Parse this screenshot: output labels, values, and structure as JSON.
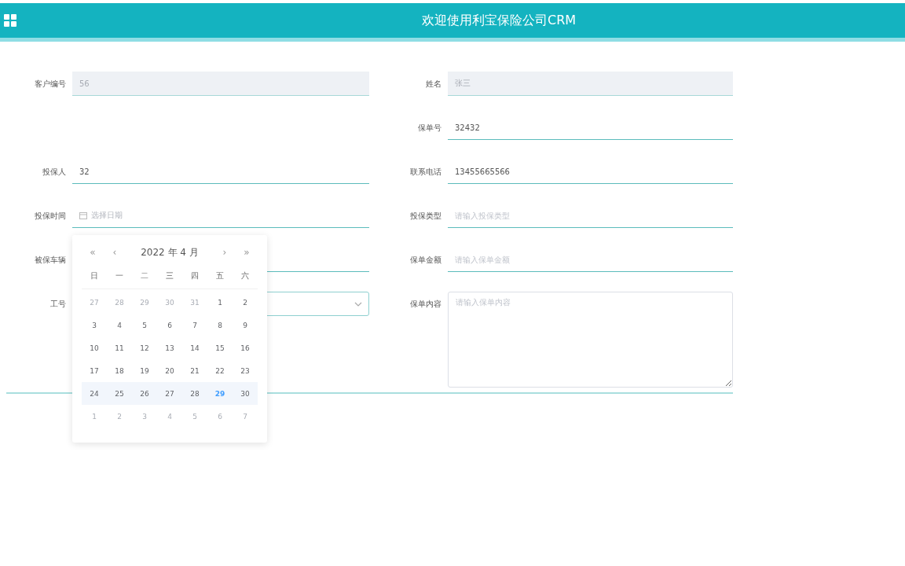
{
  "header": {
    "title": "欢迎使用利宝保险公司CRM"
  },
  "rows": [
    {
      "left": {
        "label": "客户编号",
        "kind": "input",
        "value": "56",
        "disabled": true
      },
      "right": {
        "label": "姓名",
        "kind": "input",
        "value": "张三",
        "disabled": true
      }
    },
    {
      "left": null,
      "right": {
        "label": "保单号",
        "kind": "input",
        "value": "32432",
        "disabled": false
      }
    },
    {
      "left": {
        "label": "投保人",
        "kind": "input",
        "value": "32",
        "disabled": false
      },
      "right": {
        "label": "联系电话",
        "kind": "input",
        "value": "13455665566",
        "disabled": false
      }
    },
    {
      "left": {
        "label": "投保时间",
        "kind": "date",
        "placeholder": "选择日期"
      },
      "right": {
        "label": "投保类型",
        "kind": "input",
        "placeholder": "请输入投保类型",
        "disabled": false
      }
    },
    {
      "left": {
        "label": "被保车辆",
        "kind": "input",
        "disabled": false
      },
      "right": {
        "label": "保单金额",
        "kind": "input",
        "placeholder": "请输入保单金额",
        "disabled": false
      }
    },
    {
      "left": {
        "label": "工号",
        "kind": "select"
      },
      "right": {
        "label": "保单内容",
        "kind": "textarea",
        "placeholder": "请输入保单内容"
      }
    }
  ],
  "calendar": {
    "prev_year": "«",
    "prev_month": "‹",
    "title": "2022 年  4 月",
    "next_month": "›",
    "next_year": "»",
    "weekdays": [
      "日",
      "一",
      "二",
      "三",
      "四",
      "五",
      "六"
    ],
    "weeks": [
      {
        "selected": false,
        "days": [
          {
            "day": "27",
            "muted": true,
            "today": false
          },
          {
            "day": "28",
            "muted": true,
            "today": false
          },
          {
            "day": "29",
            "muted": true,
            "today": false
          },
          {
            "day": "30",
            "muted": true,
            "today": false
          },
          {
            "day": "31",
            "muted": true,
            "today": false
          },
          {
            "day": "1",
            "muted": false,
            "today": false
          },
          {
            "day": "2",
            "muted": false,
            "today": false
          }
        ]
      },
      {
        "selected": false,
        "days": [
          {
            "day": "3",
            "muted": false,
            "today": false
          },
          {
            "day": "4",
            "muted": false,
            "today": false
          },
          {
            "day": "5",
            "muted": false,
            "today": false
          },
          {
            "day": "6",
            "muted": false,
            "today": false
          },
          {
            "day": "7",
            "muted": false,
            "today": false
          },
          {
            "day": "8",
            "muted": false,
            "today": false
          },
          {
            "day": "9",
            "muted": false,
            "today": false
          }
        ]
      },
      {
        "selected": false,
        "days": [
          {
            "day": "10",
            "muted": false,
            "today": false
          },
          {
            "day": "11",
            "muted": false,
            "today": false
          },
          {
            "day": "12",
            "muted": false,
            "today": false
          },
          {
            "day": "13",
            "muted": false,
            "today": false
          },
          {
            "day": "14",
            "muted": false,
            "today": false
          },
          {
            "day": "15",
            "muted": false,
            "today": false
          },
          {
            "day": "16",
            "muted": false,
            "today": false
          }
        ]
      },
      {
        "selected": false,
        "days": [
          {
            "day": "17",
            "muted": false,
            "today": false
          },
          {
            "day": "18",
            "muted": false,
            "today": false
          },
          {
            "day": "19",
            "muted": false,
            "today": false
          },
          {
            "day": "20",
            "muted": false,
            "today": false
          },
          {
            "day": "21",
            "muted": false,
            "today": false
          },
          {
            "day": "22",
            "muted": false,
            "today": false
          },
          {
            "day": "23",
            "muted": false,
            "today": false
          }
        ]
      },
      {
        "selected": true,
        "days": [
          {
            "day": "24",
            "muted": false,
            "today": false
          },
          {
            "day": "25",
            "muted": false,
            "today": false
          },
          {
            "day": "26",
            "muted": false,
            "today": false
          },
          {
            "day": "27",
            "muted": false,
            "today": false
          },
          {
            "day": "28",
            "muted": false,
            "today": false
          },
          {
            "day": "29",
            "muted": false,
            "today": true
          },
          {
            "day": "30",
            "muted": false,
            "today": false
          }
        ]
      },
      {
        "selected": false,
        "days": [
          {
            "day": "1",
            "muted": true,
            "today": false
          },
          {
            "day": "2",
            "muted": true,
            "today": false
          },
          {
            "day": "3",
            "muted": true,
            "today": false
          },
          {
            "day": "4",
            "muted": true,
            "today": false
          },
          {
            "day": "5",
            "muted": true,
            "today": false
          },
          {
            "day": "6",
            "muted": true,
            "today": false
          },
          {
            "day": "7",
            "muted": true,
            "today": false
          }
        ]
      }
    ]
  }
}
